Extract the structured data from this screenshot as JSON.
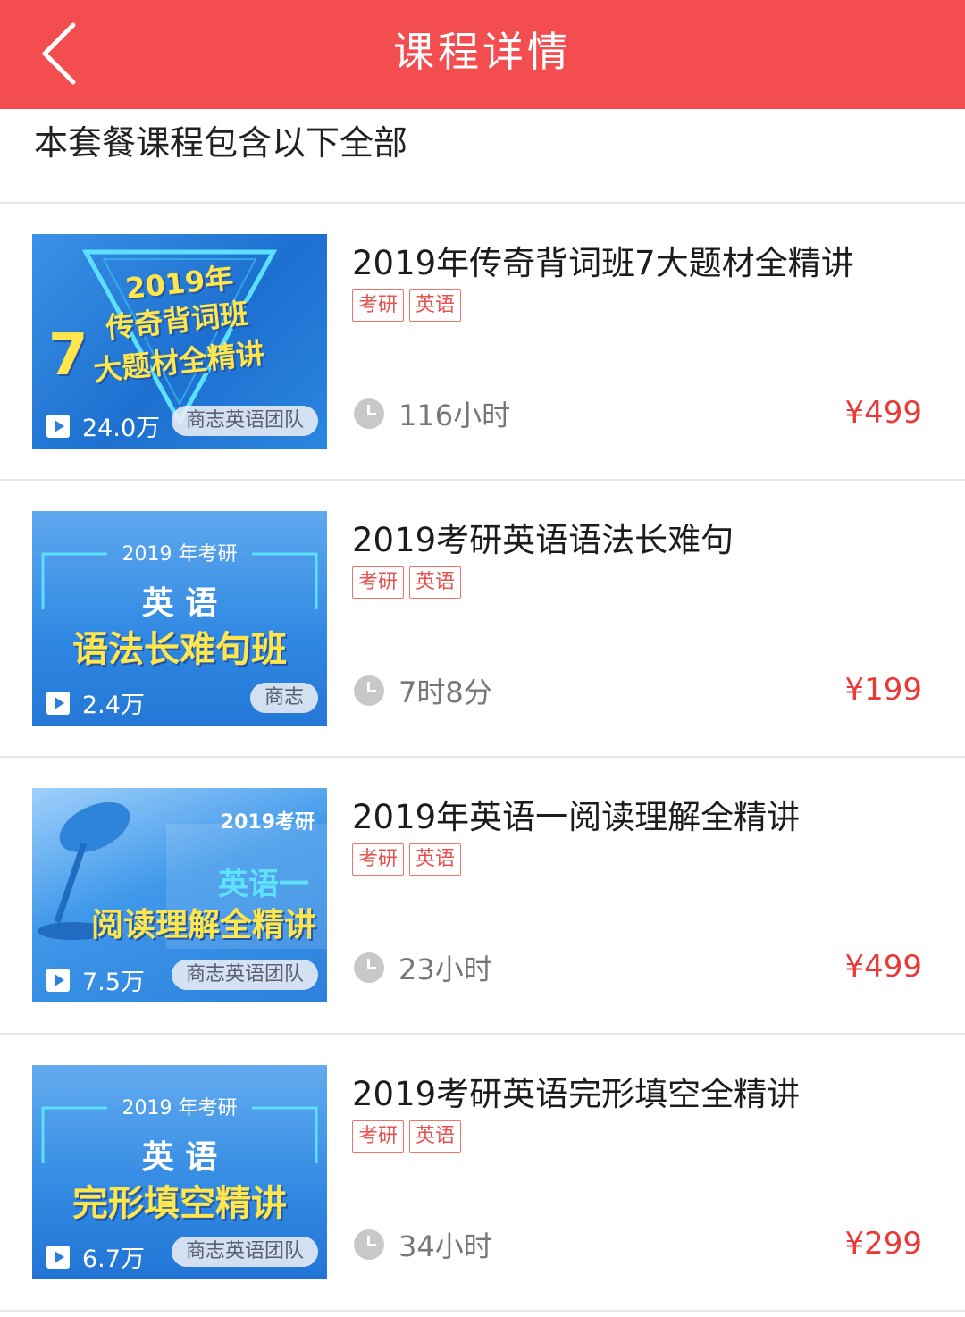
{
  "header": {
    "title": "课程详情"
  },
  "intro": "本套餐课程包含以下全部",
  "courses": [
    {
      "title": "2019年传奇背词班7大题材全精讲",
      "tags": [
        "考研",
        "英语"
      ],
      "duration": "116小时",
      "price": "¥499",
      "thumb": {
        "line1": "2019年",
        "line2": "传奇背词班",
        "line3": "7",
        "line4": "大题材全精讲",
        "views": "24.0万",
        "team": "商志英语团队"
      }
    },
    {
      "title": "2019考研英语语法长难句",
      "tags": [
        "考研",
        "英语"
      ],
      "duration": "7时8分",
      "price": "¥199",
      "thumb": {
        "line1": "2019 年考研",
        "line2": "英 语",
        "line3": "语法长难句班",
        "views": "2.4万",
        "team": "商志"
      }
    },
    {
      "title": "2019年英语一阅读理解全精讲",
      "tags": [
        "考研",
        "英语"
      ],
      "duration": "23小时",
      "price": "¥499",
      "thumb": {
        "line1": "2019考研",
        "line2": "英语一",
        "line3": "阅读理解全精讲",
        "views": "7.5万",
        "team": "商志英语团队"
      }
    },
    {
      "title": "2019考研英语完形填空全精讲",
      "tags": [
        "考研",
        "英语"
      ],
      "duration": "34小时",
      "price": "¥299",
      "thumb": {
        "line1": "2019 年考研",
        "line2": "英 语",
        "line3": "完形填空精讲",
        "views": "6.7万",
        "team": "商志英语团队"
      }
    }
  ]
}
